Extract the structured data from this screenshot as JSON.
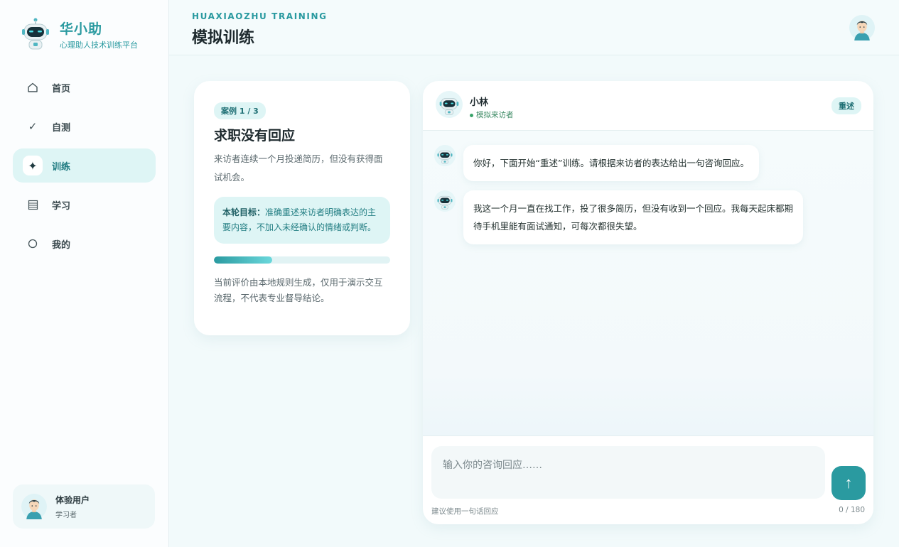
{
  "brand": {
    "name": "华小助",
    "subtitle": "心理助人技术训练平台"
  },
  "nav": {
    "items": [
      {
        "label": "首页",
        "icon": "home-icon",
        "active": false
      },
      {
        "label": "自测",
        "icon": "check-icon",
        "active": false
      },
      {
        "label": "训练",
        "icon": "sparkle-icon",
        "active": true
      },
      {
        "label": "学习",
        "icon": "list-icon",
        "active": false
      },
      {
        "label": "我的",
        "icon": "circle-icon",
        "active": false
      }
    ]
  },
  "user": {
    "name": "体验用户",
    "role": "学习者"
  },
  "header": {
    "eyebrow": "HUAXIAOZHU TRAINING",
    "title": "模拟训练"
  },
  "case": {
    "badge": "案例 1 / 3",
    "title": "求职没有回应",
    "description": "来访者连续一个月投递简历，但没有获得面试机会。",
    "goal_label": "本轮目标：",
    "goal_text": "准确重述来访者明确表达的主要内容，不加入未经确认的情绪或判断。",
    "progress": 0.33,
    "note": "当前评价由本地规则生成，仅用于演示交互流程，不代表专业督导结论。"
  },
  "chat": {
    "name": "小林",
    "status": "模拟来访者",
    "mode": "重述",
    "messages": [
      {
        "text": "你好，下面开始“重述”训练。请根据来访者的表达给出一句咨询回应。"
      },
      {
        "text": "我这一个月一直在找工作，投了很多简历，但没有收到一个回应。我每天起床都期待手机里能有面试通知，可每次都很失望。"
      }
    ],
    "input_placeholder": "输入你的咨询回应……",
    "send_icon": "↑",
    "hint": "建议使用一句话回应",
    "counter": "0 / 180"
  },
  "colors": {
    "accent": "#2a9aa0",
    "accent_light": "#def5f5",
    "status": "#3aa36a"
  }
}
